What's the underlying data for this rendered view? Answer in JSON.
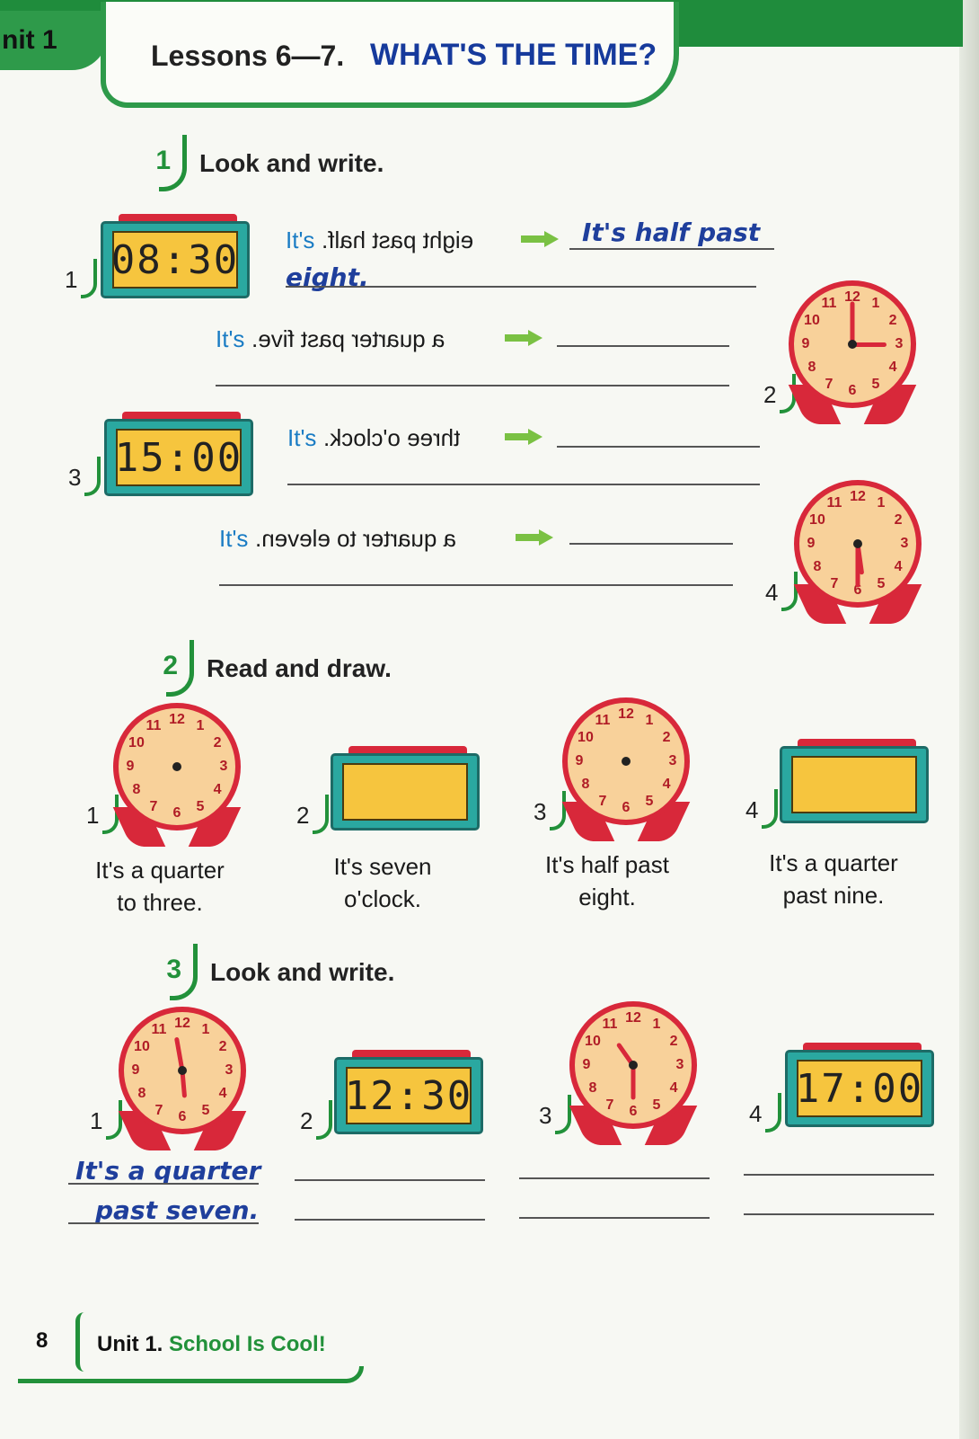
{
  "header": {
    "unit_tab": "nit 1",
    "lessons": "Lessons 6—7.",
    "title": "WHAT'S THE TIME?"
  },
  "ex1": {
    "number": "1",
    "instruction": "Look and write.",
    "items": [
      {
        "num": "1",
        "its": "It's",
        "mirrored": "eight past half.",
        "answer_line1": "It's half past",
        "answer_line2": "eight.",
        "display": "08:30"
      },
      {
        "num": "2",
        "its": "It's",
        "mirrored": "a quarter past five."
      },
      {
        "num": "3",
        "its": "It's",
        "mirrored": "three o'clock.",
        "display": "15:00"
      },
      {
        "num": "4",
        "its": "It's",
        "mirrored": "a quarter to eleven."
      }
    ]
  },
  "ex2": {
    "number": "2",
    "instruction": "Read and draw.",
    "items": [
      {
        "num": "1",
        "caption_line1": "It's a quarter",
        "caption_line2": "to three."
      },
      {
        "num": "2",
        "caption_line1": "It's seven",
        "caption_line2": "o'clock."
      },
      {
        "num": "3",
        "caption_line1": "It's half past",
        "caption_line2": "eight."
      },
      {
        "num": "4",
        "caption_line1": "It's a quarter",
        "caption_line2": "past nine."
      }
    ]
  },
  "ex3": {
    "number": "3",
    "instruction": "Look and write.",
    "items": [
      {
        "num": "1",
        "answer_line1": "It's a quarter",
        "answer_line2": "past seven."
      },
      {
        "num": "2",
        "display": "12:30"
      },
      {
        "num": "3"
      },
      {
        "num": "4",
        "display": "17:00"
      }
    ]
  },
  "clock_numerals": [
    "12",
    "1",
    "2",
    "3",
    "4",
    "5",
    "6",
    "7",
    "8",
    "9",
    "10",
    "11"
  ],
  "footer": {
    "page_number": "8",
    "unit": "Unit 1.",
    "unit_title": "School Is Cool!"
  }
}
